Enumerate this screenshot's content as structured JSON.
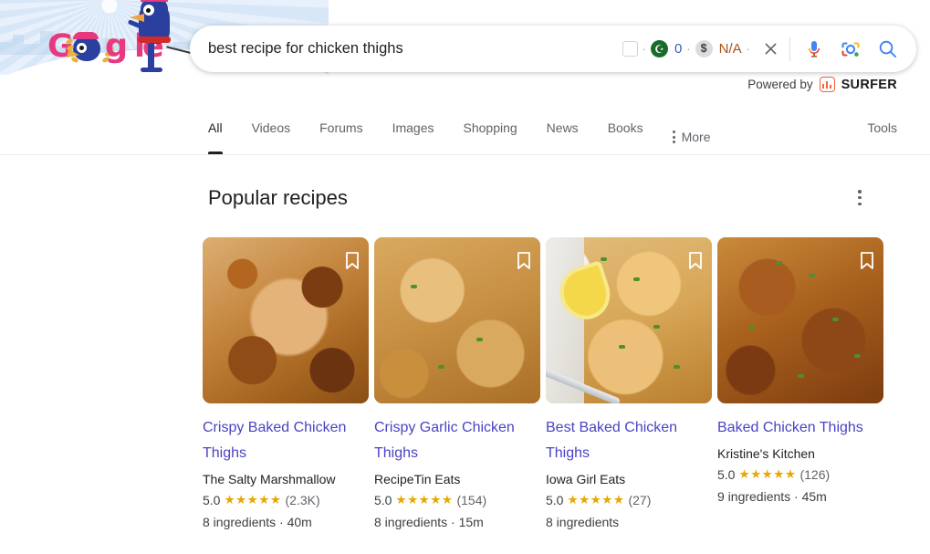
{
  "header": {
    "doodle_alt": "google-doodle-bird",
    "logo_text": "Google"
  },
  "search": {
    "value": "best recipe for chicken thighs",
    "placeholder": "Search",
    "meta": {
      "checkbox_checked": false,
      "green_badge_glyph": "☪",
      "green_badge_count": "0",
      "dollar_glyph": "$",
      "dollar_value": "N/A",
      "separator": "·"
    },
    "clear_label": "Clear",
    "voice_label": "Search by voice",
    "lens_label": "Search by image",
    "submit_label": "Google Search"
  },
  "powered_by": {
    "prefix": "Powered by",
    "brand": "SURFER",
    "brand_color": "#f4603e"
  },
  "tabs": [
    {
      "label": "All",
      "active": true
    },
    {
      "label": "Videos",
      "active": false
    },
    {
      "label": "Forums",
      "active": false
    },
    {
      "label": "Images",
      "active": false
    },
    {
      "label": "Shopping",
      "active": false
    },
    {
      "label": "News",
      "active": false
    },
    {
      "label": "Books",
      "active": false
    }
  ],
  "more_label": "More",
  "tools_label": "Tools",
  "section": {
    "title": "Popular recipes",
    "options_label": "More options"
  },
  "cards": [
    {
      "title": "Crispy Baked Chicken Thighs",
      "source": "The Salty Marshmallow",
      "rating": "5.0",
      "stars": "★★★★★",
      "reviews": "(2.3K)",
      "facts": "8 ingredients · 40m",
      "save_label": "Save"
    },
    {
      "title": "Crispy Garlic Chicken Thighs",
      "source": "RecipeTin Eats",
      "rating": "5.0",
      "stars": "★★★★★",
      "reviews": "(154)",
      "facts": "8 ingredients · 15m",
      "save_label": "Save"
    },
    {
      "title": "Best Baked Chicken Thighs",
      "source": "Iowa Girl Eats",
      "rating": "5.0",
      "stars": "★★★★★",
      "reviews": "(27)",
      "facts": "8 ingredients",
      "save_label": "Save"
    },
    {
      "title": "Baked Chicken Thighs",
      "source": "Kristine's Kitchen",
      "rating": "5.0",
      "stars": "★★★★★",
      "reviews": "(126)",
      "facts": "9 ingredients · 45m",
      "save_label": "Save"
    }
  ],
  "colors": {
    "link": "#4a43c4",
    "star": "#e8a800",
    "text": "#202124",
    "muted": "#5f6368"
  }
}
